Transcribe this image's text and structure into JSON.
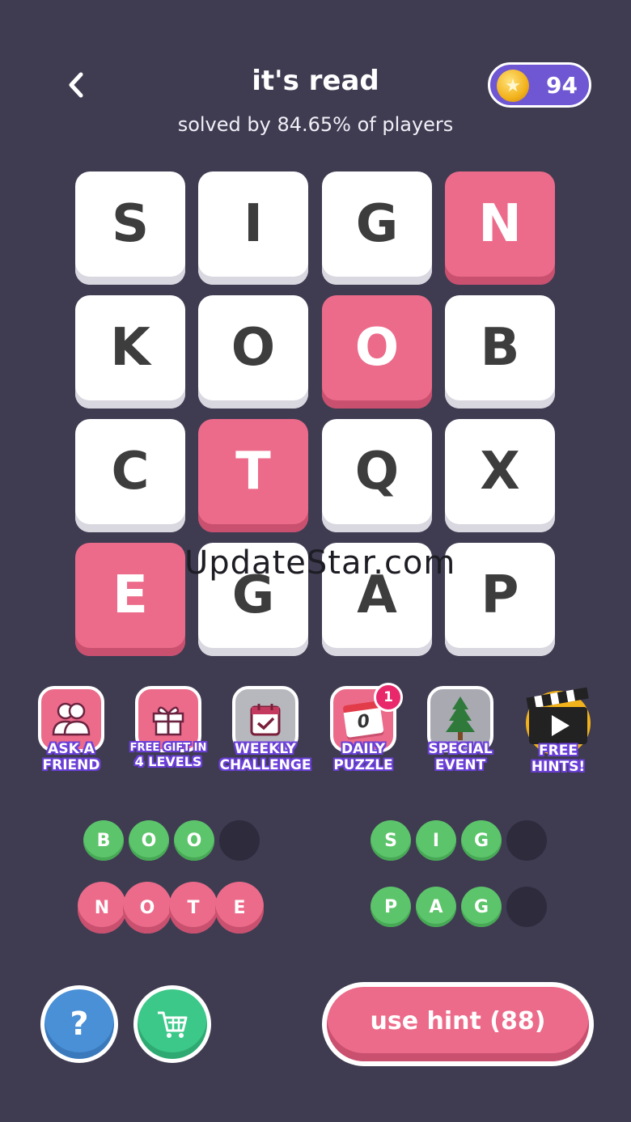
{
  "header": {
    "title": "it's read",
    "subtitle": "solved by 84.65% of players",
    "coins": "94"
  },
  "grid": {
    "rows": [
      [
        {
          "letter": "S",
          "state": "white"
        },
        {
          "letter": "I",
          "state": "white"
        },
        {
          "letter": "G",
          "state": "white"
        },
        {
          "letter": "N",
          "state": "pink"
        }
      ],
      [
        {
          "letter": "K",
          "state": "white"
        },
        {
          "letter": "O",
          "state": "white"
        },
        {
          "letter": "O",
          "state": "pink"
        },
        {
          "letter": "B",
          "state": "white"
        }
      ],
      [
        {
          "letter": "C",
          "state": "white"
        },
        {
          "letter": "T",
          "state": "pink"
        },
        {
          "letter": "Q",
          "state": "white"
        },
        {
          "letter": "X",
          "state": "white"
        }
      ],
      [
        {
          "letter": "E",
          "state": "pink"
        },
        {
          "letter": "G",
          "state": "white"
        },
        {
          "letter": "A",
          "state": "white"
        },
        {
          "letter": "P",
          "state": "white"
        }
      ]
    ]
  },
  "watermark": "UpdateStar.com",
  "powerups": {
    "ask_friend": {
      "line1": "ASK A",
      "line2": "FRIEND"
    },
    "free_gift": {
      "line1": "FREE GIFT IN",
      "line2": "4 LEVELS"
    },
    "weekly": {
      "line1": "WEEKLY",
      "line2": "CHALLENGE"
    },
    "daily": {
      "line1": "DAILY",
      "line2": "PUZZLE",
      "badge": "1",
      "calendar_digit": "0"
    },
    "special": {
      "line1": "SPECIAL",
      "line2": "EVENT"
    },
    "free_hints": {
      "line1": "FREE",
      "line2": "HINTS!"
    }
  },
  "words": {
    "boo": [
      "B",
      "O",
      "O"
    ],
    "note": [
      "N",
      "O",
      "T",
      "E"
    ],
    "sig": [
      "S",
      "I",
      "G"
    ],
    "pag": [
      "P",
      "A",
      "G"
    ]
  },
  "buttons": {
    "help": "?",
    "hint": "use hint (88)"
  },
  "colors": {
    "background": "#3f3c52",
    "pink": "#ec6b8a",
    "green": "#5cc46a",
    "coin_pill": "#6f56d3"
  }
}
